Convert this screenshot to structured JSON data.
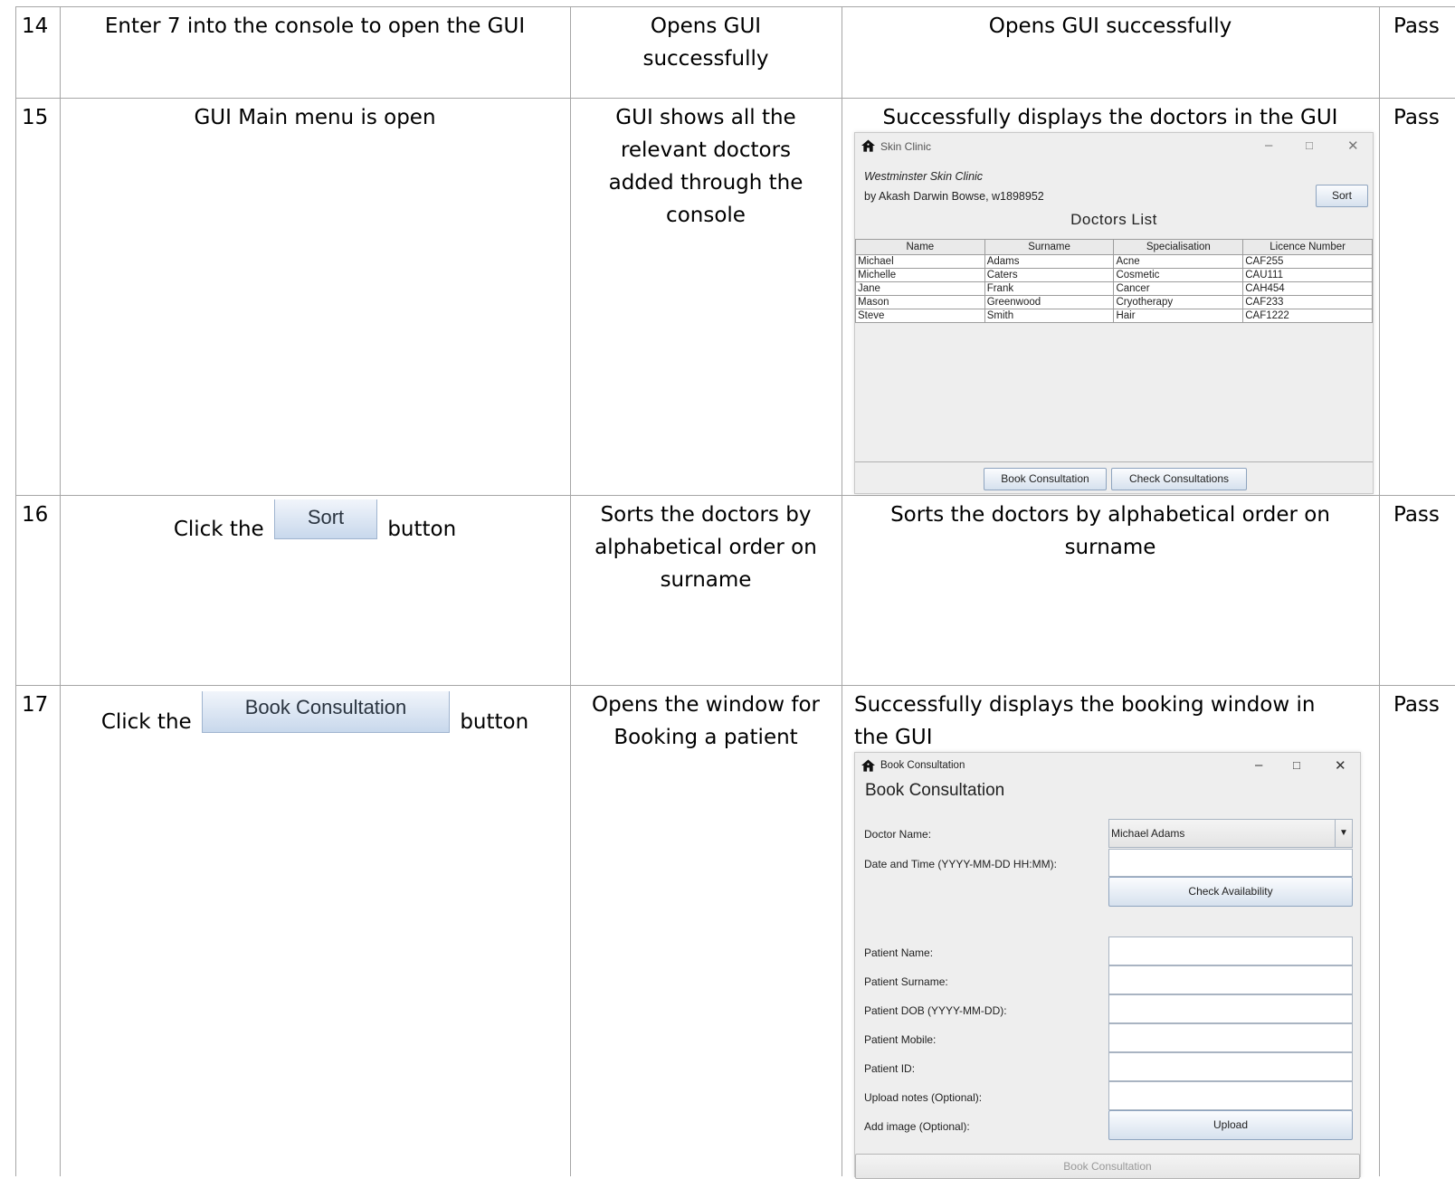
{
  "rows": [
    {
      "num": "14",
      "step": "Enter 7 into the console to open the GUI",
      "expected_lines": [
        "Opens GUI",
        "successfully"
      ],
      "actual_lines": [
        "Opens GUI successfully"
      ],
      "result": "Pass"
    },
    {
      "num": "15",
      "step": "GUI Main menu is open",
      "expected_lines": [
        "GUI shows all the",
        "relevant doctors",
        "added through the",
        "console"
      ],
      "actual_lines": [
        "Successfully displays the doctors in the GUI"
      ],
      "result": "Pass"
    },
    {
      "num": "16",
      "step_prefix": "Click the",
      "step_button": "Sort",
      "step_suffix": "button",
      "expected_lines": [
        "Sorts the doctors by",
        "alphabetical order on",
        "surname"
      ],
      "actual_lines": [
        "Sorts the doctors by alphabetical order on",
        "surname"
      ],
      "result": "Pass"
    },
    {
      "num": "17",
      "step_prefix": "Click the",
      "step_button": "Book Consultation",
      "step_suffix": "button",
      "expected_lines": [
        "Opens the window for",
        "Booking a patient"
      ],
      "actual_lines": [
        "Successfully displays the booking window in",
        "the GUI"
      ],
      "result": "Pass"
    }
  ],
  "clinic_window": {
    "title": "Skin Clinic",
    "clinic_name": "Westminster Skin Clinic",
    "author": "by Akash Darwin Bowse, w1898952",
    "sort_label": "Sort",
    "heading": "Doctors List",
    "columns": [
      "Name",
      "Surname",
      "Specialisation",
      "Licence Number"
    ],
    "doctors": [
      [
        "Michael",
        "Adams",
        "Acne",
        "CAF255"
      ],
      [
        "Michelle",
        "Caters",
        "Cosmetic",
        "CAU111"
      ],
      [
        "Jane",
        "Frank",
        "Cancer",
        "CAH454"
      ],
      [
        "Mason",
        "Greenwood",
        "Cryotherapy",
        "CAF233"
      ],
      [
        "Steve",
        "Smith",
        "Hair",
        "CAF1222"
      ]
    ],
    "book_label": "Book Consultation",
    "check_label": "Check Consultations"
  },
  "booking_window": {
    "title": "Book Consultation",
    "heading": "Book Consultation",
    "doctor_label": "Doctor Name:",
    "doctor_value": "Michael Adams",
    "datetime_label": "Date and Time (YYYY-MM-DD HH:MM):",
    "check_label": "Check Availability",
    "patient_name_label": "Patient Name:",
    "patient_surname_label": "Patient Surname:",
    "patient_dob_label": "Patient DOB (YYYY-MM-DD):",
    "patient_mobile_label": "Patient Mobile:",
    "patient_id_label": "Patient ID:",
    "notes_label": "Upload notes (Optional):",
    "image_label": "Add image (Optional):",
    "upload_label": "Upload",
    "submit_label": "Book Consultation"
  }
}
